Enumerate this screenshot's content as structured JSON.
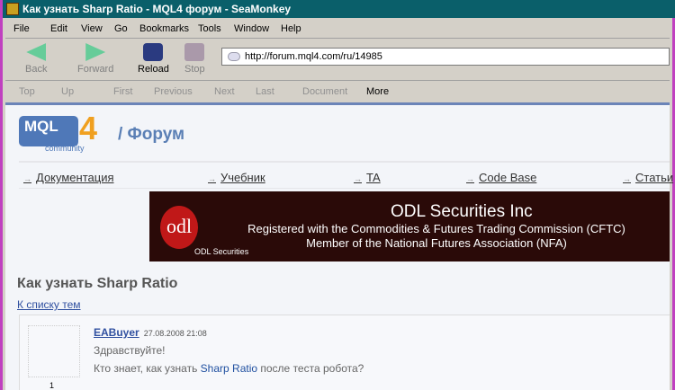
{
  "window": {
    "title": "Как узнать Sharp Ratio - MQL4 форум - SeaMonkey"
  },
  "menu": [
    "File",
    "Edit",
    "View",
    "Go",
    "Bookmarks",
    "Tools",
    "Window",
    "Help"
  ],
  "nav": {
    "back": "Back",
    "forward": "Forward",
    "reload": "Reload",
    "stop": "Stop",
    "url": "http://forum.mql4.com/ru/14985"
  },
  "linkbar": [
    "Top",
    "Up",
    "First",
    "Previous",
    "Next",
    "Last",
    "Document",
    "More"
  ],
  "site": {
    "logo": "MQL",
    "logo_num": "4",
    "logo_sub": "community",
    "section": "/  Форум",
    "nav": [
      "Документация",
      "Учебник",
      "TA",
      "Code Base",
      "Статьи"
    ],
    "banner": {
      "logo": "odl",
      "title": "ODL Securities Inc",
      "line1": "Registered with the Commodities & Futures Trading Commission (CFTC)",
      "line2": "Member of the National Futures Association (NFA)",
      "brand": "ODL Securities"
    }
  },
  "topic": {
    "title": "Как узнать Sharp Ratio",
    "back_link": "К списку тем",
    "post": {
      "author": "EABuyer",
      "date": "27.08.2008 21:08",
      "greeting": "Здравствуйте!",
      "text_before": "Кто знает, как узнать ",
      "link": "Sharp Ratio",
      "text_after": " после теста робота?",
      "rank": "1"
    }
  }
}
